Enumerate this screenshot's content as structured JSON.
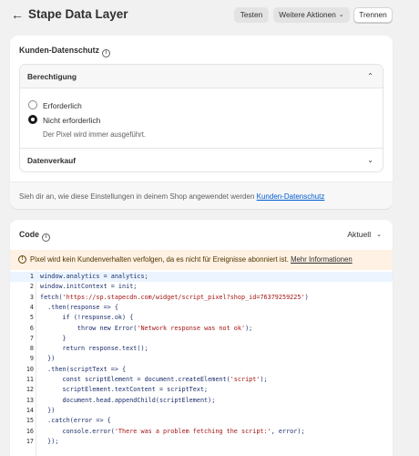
{
  "header": {
    "title": "Stape Data Layer",
    "back_glyph": "←",
    "test_label": "Testen",
    "more_actions_label": "Weitere Aktionen",
    "disconnect_label": "Trennen"
  },
  "privacy": {
    "title": "Kunden-Datenschutz",
    "permission_title": "Berechtigung",
    "options": [
      {
        "label": "Erforderlich",
        "checked": false
      },
      {
        "label": "Nicht erforderlich",
        "checked": true
      }
    ],
    "help_text": "Der Pixel wird immer ausgeführt.",
    "data_sale_title": "Datenverkauf",
    "footer_text": "Sieh dir an, wie diese Einstellungen in deinem Shop angewendet werden",
    "footer_link": "Kunden-Datenschutz"
  },
  "code_panel": {
    "title": "Code",
    "version_select": "Aktuell",
    "warning_text": "Pixel wird kein Kundenverhalten verfolgen, da es nicht für Ereignisse abonniert ist.",
    "warning_link": "Mehr Informationen",
    "lines": [
      "window.analytics = analytics;",
      "window.initContext = init;",
      "fetch('https://sp.stapecdn.com/widget/script_pixel?shop_id=76379259225')",
      "  .then(response => {",
      "      if (!response.ok) {",
      "          throw new Error('Network response was not ok');",
      "      }",
      "      return response.text();",
      "  })",
      "  .then(scriptText => {",
      "      const scriptElement = document.createElement('script');",
      "      scriptElement.textContent = scriptText;",
      "      document.head.appendChild(scriptElement);",
      "  })",
      "  .catch(error => {",
      "      console.error('There was a problem fetching the script:', error);",
      "  });"
    ]
  },
  "colors": {
    "link": "#005bd3",
    "warning_bg": "#fff1e3",
    "active_line": "#ebf4ff",
    "string": "#a31515"
  }
}
